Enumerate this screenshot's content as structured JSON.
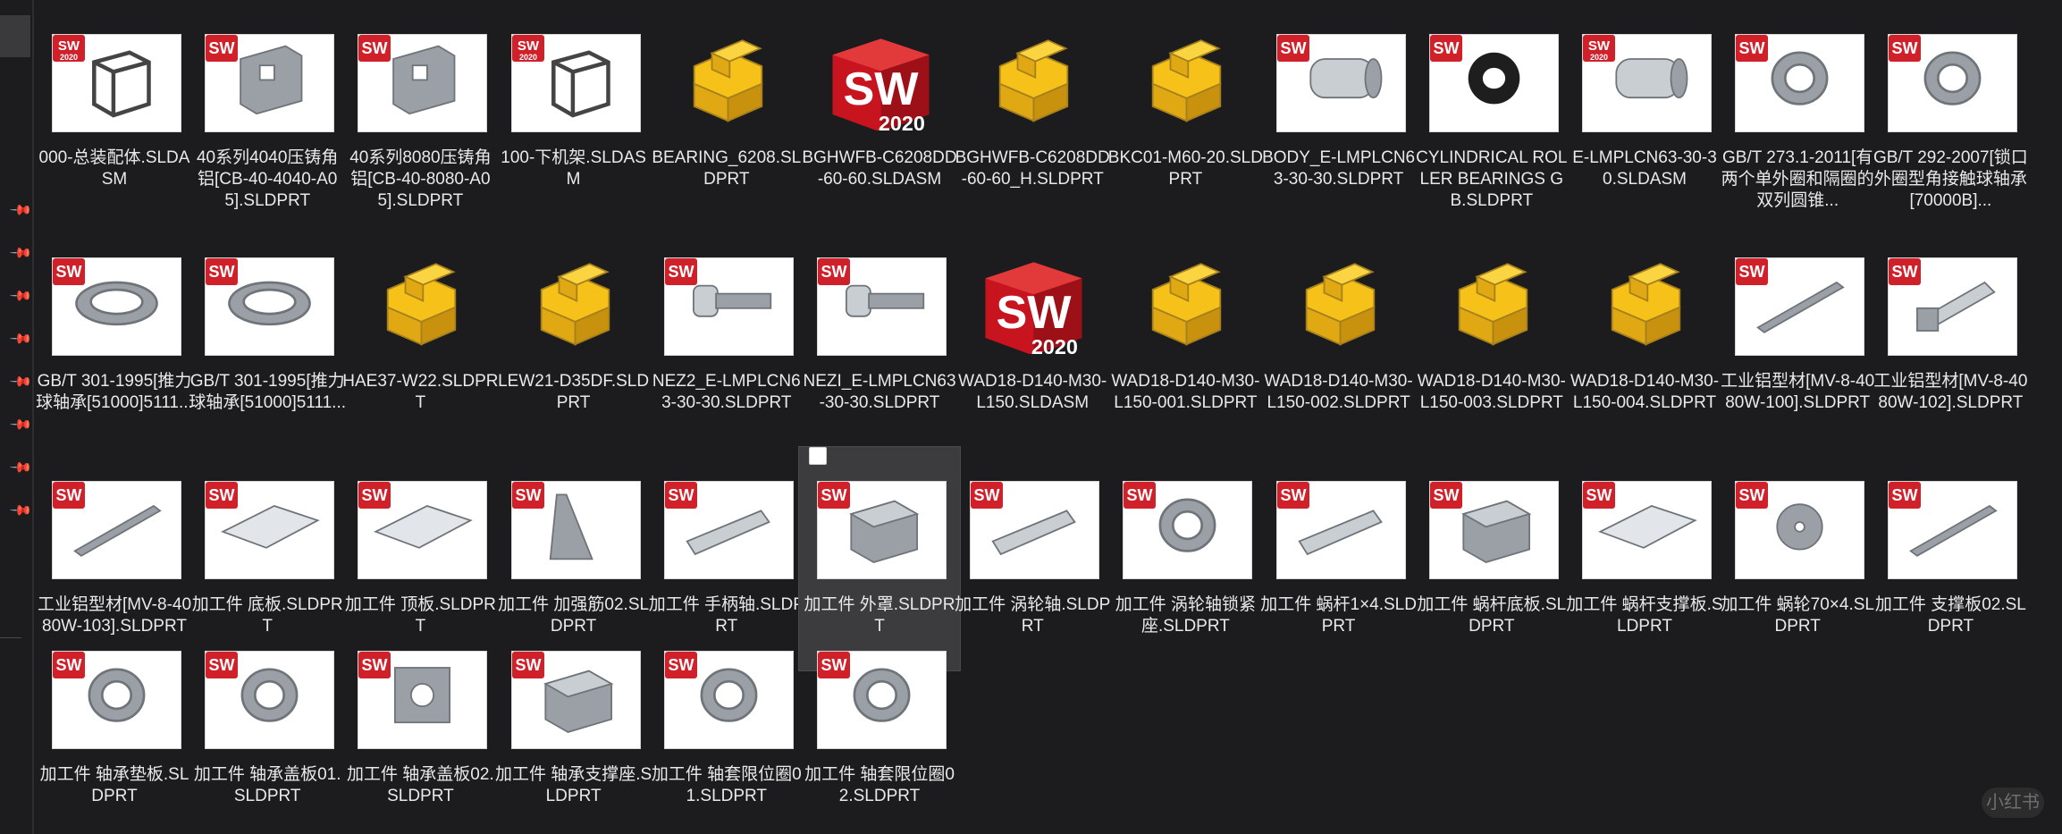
{
  "files": [
    {
      "name": "000-总装配体.SLDASM",
      "icon": "assembly-thumbnail",
      "badge": "2020"
    },
    {
      "name": "40系列4040压铸角铝[CB-40-4040-A05].SLDPRT",
      "icon": "corner-bracket-thumbnail",
      "badge": "sw"
    },
    {
      "name": "40系列8080压铸角铝[CB-40-8080-A05].SLDPRT",
      "icon": "corner-bracket-thumbnail",
      "badge": "sw"
    },
    {
      "name": "100-下机架.SLDASM",
      "icon": "frame-thumbnail",
      "badge": "2020"
    },
    {
      "name": "BEARING_6208.SLDPRT",
      "icon": "part-icon-yellow",
      "badge": ""
    },
    {
      "name": "BGHWFB-C6208DD-60-60.SLDASM",
      "icon": "solidworks-2020-icon",
      "badge": ""
    },
    {
      "name": "BGHWFB-C6208DD-60-60_H.SLDPRT",
      "icon": "part-icon-yellow",
      "badge": ""
    },
    {
      "name": "BKC01-M60-20.SLDPRT",
      "icon": "part-icon-yellow",
      "badge": ""
    },
    {
      "name": "BODY_E-LMPLCN63-30-30.SLDPRT",
      "icon": "coupling-thumbnail",
      "badge": "sw"
    },
    {
      "name": "CYLINDRICAL ROLLER BEARINGS GB.SLDPRT",
      "icon": "roller-thumbnail",
      "badge": "sw"
    },
    {
      "name": "E-LMPLCN63-30-30.SLDASM",
      "icon": "coupling-thumbnail",
      "badge": "2020"
    },
    {
      "name": "GB/T 273.1-2011[有两个单外圈和隔圈的双列圆锥...",
      "icon": "bearing-thumbnail",
      "badge": "sw"
    },
    {
      "name": "GB/T 292-2007[锁口外圈型角接触球轴承[70000B]...",
      "icon": "bearing-thumbnail",
      "badge": "sw"
    },
    {
      "name": "GB/T 301-1995[推力球轴承[51000]5111...",
      "icon": "thrust-bearing-thumbnail",
      "badge": "sw"
    },
    {
      "name": "GB/T 301-1995[推力球轴承[51000]5111...",
      "icon": "thrust-bearing-thumbnail",
      "badge": "sw"
    },
    {
      "name": "HAE37-W22.SLDPRT",
      "icon": "part-icon-yellow",
      "badge": ""
    },
    {
      "name": "LEW21-D35DF.SLDPRT",
      "icon": "part-icon-yellow",
      "badge": ""
    },
    {
      "name": "NEZ2_E-LMPLCN63-30-30.SLDPRT",
      "icon": "screw-thumbnail",
      "badge": "sw"
    },
    {
      "name": "NEZI_E-LMPLCN63-30-30.SLDPRT",
      "icon": "screw-thumbnail",
      "badge": "sw"
    },
    {
      "name": "WAD18-D140-M30-L150.SLDASM",
      "icon": "solidworks-2020-icon",
      "badge": ""
    },
    {
      "name": "WAD18-D140-M30-L150-001.SLDPRT",
      "icon": "part-icon-yellow",
      "badge": ""
    },
    {
      "name": "WAD18-D140-M30-L150-002.SLDPRT",
      "icon": "part-icon-yellow",
      "badge": ""
    },
    {
      "name": "WAD18-D140-M30-L150-003.SLDPRT",
      "icon": "part-icon-yellow",
      "badge": ""
    },
    {
      "name": "WAD18-D140-M30-L150-004.SLDPRT",
      "icon": "part-icon-yellow",
      "badge": ""
    },
    {
      "name": "工业铝型材[MV-8-4080W-100].SLDPRT",
      "icon": "profile-thumbnail",
      "badge": "sw"
    },
    {
      "name": "工业铝型材[MV-8-4080W-102].SLDPRT",
      "icon": "profile-end-thumbnail",
      "badge": "sw"
    },
    {
      "name": "工业铝型材[MV-8-4080W-103].SLDPRT",
      "icon": "profile-thumbnail",
      "badge": "sw"
    },
    {
      "name": "加工件 底板.SLDPRT",
      "icon": "plate-thumbnail",
      "badge": "sw"
    },
    {
      "name": "加工件 顶板.SLDPRT",
      "icon": "plate-thumbnail",
      "badge": "sw"
    },
    {
      "name": "加工件 加强筋02.SLDPRT",
      "icon": "rib-thumbnail",
      "badge": "sw"
    },
    {
      "name": "加工件 手柄轴.SLDPRT",
      "icon": "shaft-thumbnail",
      "badge": "sw"
    },
    {
      "name": "加工件 外罩.SLDPRT",
      "icon": "cover-thumbnail",
      "badge": "sw",
      "selected": true
    },
    {
      "name": "加工件 涡轮轴.SLDPRT",
      "icon": "shaft-thumbnail",
      "badge": "sw"
    },
    {
      "name": "加工件 涡轮轴锁紧座.SLDPRT",
      "icon": "ring-thumbnail",
      "badge": "sw"
    },
    {
      "name": "加工件 蜗杆1×4.SLDPRT",
      "icon": "worm-thumbnail",
      "badge": "sw"
    },
    {
      "name": "加工件 蜗杆底板.SLDPRT",
      "icon": "block-thumbnail",
      "badge": "sw"
    },
    {
      "name": "加工件 蜗杆支撑板.SLDPRT",
      "icon": "plate-thumbnail",
      "badge": "sw"
    },
    {
      "name": "加工件 蜗轮70×4.SLDPRT",
      "icon": "gear-thumbnail",
      "badge": "sw"
    },
    {
      "name": "加工件 支撑板02.SLDPRT",
      "icon": "bar-thumbnail",
      "badge": "sw"
    },
    {
      "name": "加工件 轴承垫板.SLDPRT",
      "icon": "ring-thumbnail",
      "badge": "sw"
    },
    {
      "name": "加工件 轴承盖板01.SLDPRT",
      "icon": "flange-thumbnail",
      "badge": "sw"
    },
    {
      "name": "加工件 轴承盖板02.SLDPRT",
      "icon": "square-flange-thumbnail",
      "badge": "sw"
    },
    {
      "name": "加工件 轴承支撑座.SLDPRT",
      "icon": "support-thumbnail",
      "badge": "sw"
    },
    {
      "name": "加工件 轴套限位圈01.SLDPRT",
      "icon": "ring-thumbnail",
      "badge": "sw"
    },
    {
      "name": "加工件 轴套限位圈02.SLDPRT",
      "icon": "ring-thumbnail",
      "badge": "sw"
    }
  ],
  "watermark": "小红书",
  "colors": {
    "background": "#1c1c1e",
    "selected": "#3c3c3e",
    "sw_red": "#d0202a",
    "part_yellow": "#f6c21a"
  }
}
